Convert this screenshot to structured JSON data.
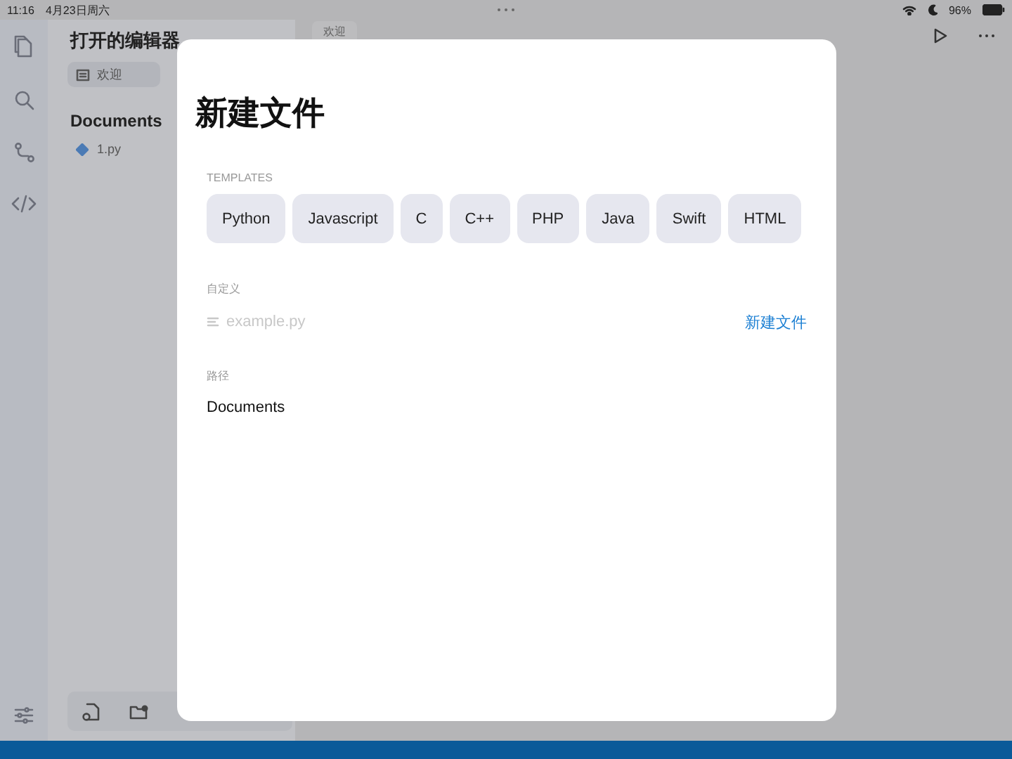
{
  "status_bar": {
    "time": "11:16",
    "date": "4月23日周六",
    "battery": "96%"
  },
  "sidebar": {
    "title": "打开的编辑器",
    "open_editors": [
      {
        "label": "欢迎"
      }
    ],
    "folder": "Documents",
    "files": [
      {
        "label": "1.py"
      }
    ]
  },
  "editor": {
    "tabs": [
      {
        "label": "欢迎"
      }
    ]
  },
  "dialog": {
    "title": "新建文件",
    "templates_label": "TEMPLATES",
    "templates": [
      "Python",
      "Javascript",
      "C",
      "C++",
      "PHP",
      "Java",
      "Swift",
      "HTML"
    ],
    "custom_label": "自定义",
    "filename": {
      "placeholder": "example.py"
    },
    "create_button": "新建文件",
    "path_label": "路径",
    "path": "Documents"
  }
}
